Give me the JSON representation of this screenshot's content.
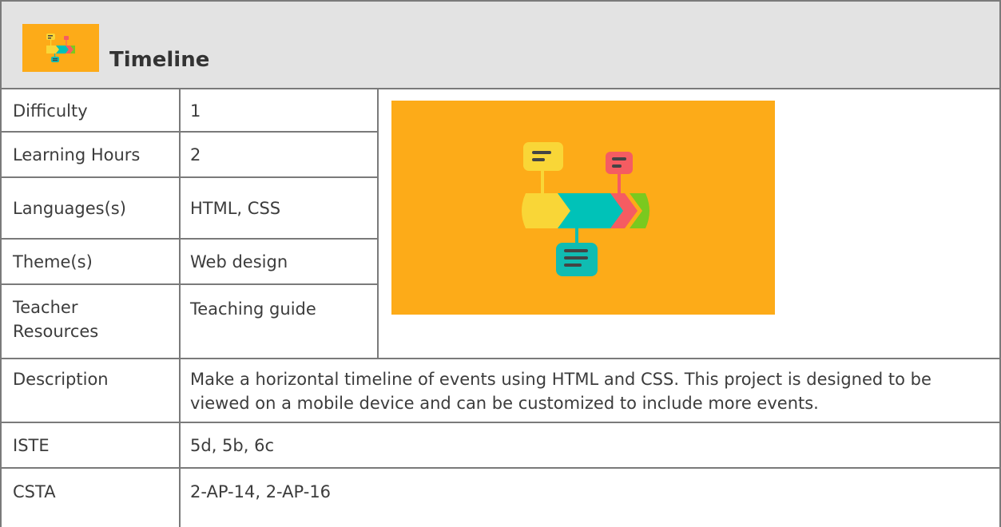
{
  "card": {
    "title": "Timeline",
    "rows": [
      {
        "label": "Difficulty",
        "value": "1"
      },
      {
        "label": "Learning Hours",
        "value": "2"
      },
      {
        "label": "Languages(s)",
        "value": "HTML, CSS"
      },
      {
        "label": "Theme(s)",
        "value": "Web design"
      },
      {
        "label": "Teacher Resources",
        "value": "Teaching guide"
      }
    ],
    "description": {
      "label": "Description",
      "value": "Make a horizontal timeline of events using HTML and CSS. This project is designed to be viewed on a mobile device and can be customized to include more events."
    },
    "iste": {
      "label": "ISTE",
      "value": "5d, 5b, 6c"
    },
    "csta": {
      "label": "CSTA",
      "value": "2-AP-14, 2-AP-16"
    }
  },
  "colors": {
    "image_background": "#fdab18",
    "header_background": "#e3e3e3",
    "border": "#7a7a7a",
    "yellow": "#f9d637",
    "teal": "#00c2b8",
    "red": "#f55c62",
    "green": "#7ac91f",
    "dark_teal": "#10bcb2"
  },
  "icons": [
    "timeline-project-icon",
    "timeline-illustration"
  ]
}
